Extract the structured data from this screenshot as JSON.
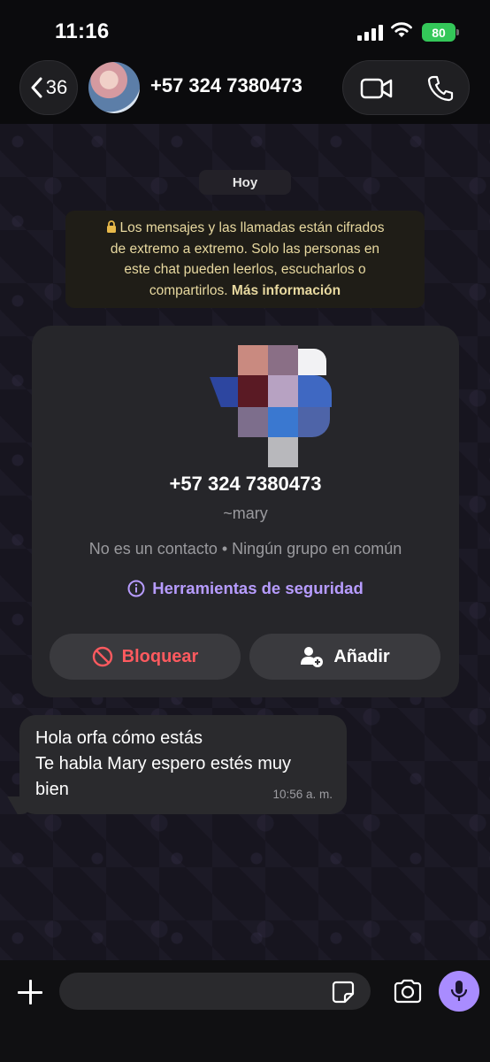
{
  "status_bar": {
    "time": "11:16",
    "battery": "80"
  },
  "header": {
    "back_count": "36",
    "contact_name": "+57 324 7380473"
  },
  "chat": {
    "date_label": "Hoy",
    "encryption_notice": {
      "lines": [
        "Los mensajes y las llamadas están cifrados",
        "de extremo a extremo. Solo las personas en",
        "este chat pueden leerlos, escucharlos o",
        "compartirlos."
      ],
      "link": "Más información"
    },
    "contact_card": {
      "phone": "+57 324 7380473",
      "alias": "~mary",
      "meta": "No es un contacto • Ningún grupo en común",
      "safety_tools": "Herramientas de seguridad",
      "block_label": "Bloquear",
      "add_label": "Añadir"
    },
    "messages": [
      {
        "lines": [
          "Hola orfa cómo estás",
          "Te habla Mary espero estés muy",
          "bien"
        ],
        "time": "10:56 a. m."
      }
    ]
  },
  "input": {
    "placeholder": ""
  },
  "colors": {
    "accent": "#a98cff",
    "block": "#ff5a5f",
    "notice_text": "#e8d9a0",
    "battery": "#34c759"
  },
  "icons": [
    "back-chevron-icon",
    "video-call-icon",
    "phone-call-icon",
    "lock-icon",
    "info-icon",
    "block-icon",
    "add-person-icon",
    "plus-icon",
    "sticker-icon",
    "camera-icon",
    "microphone-icon"
  ]
}
